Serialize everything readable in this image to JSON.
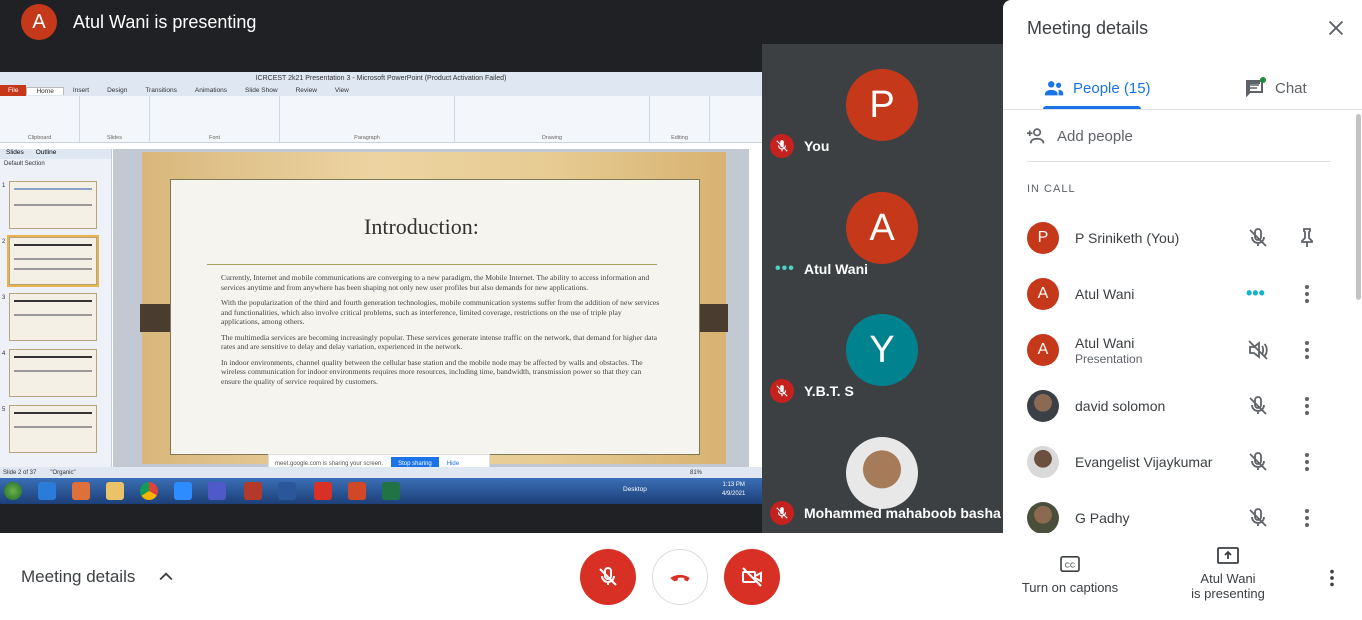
{
  "presenter": {
    "initial": "A",
    "title": "Atul Wani is presenting",
    "color": "#c5391a"
  },
  "shared_screen": {
    "window_title": "ICRCEST 2k21 Presentation 3 - Microsoft PowerPoint (Product Activation Failed)",
    "ribbon_tabs": [
      "File",
      "Home",
      "Insert",
      "Design",
      "Transitions",
      "Animations",
      "Slide Show",
      "Review",
      "View"
    ],
    "ribbon_groups": [
      "Clipboard",
      "Slides",
      "Font",
      "Paragraph",
      "Drawing",
      "Editing"
    ],
    "panel_tabs": [
      "Slides",
      "Outline"
    ],
    "section": "Default Section",
    "slide_title": "Introduction:",
    "bullets": [
      "Currently, Internet and mobile communications are converging to a new paradigm, the Mobile Internet. The ability to access information and services anytime and from anywhere has been shaping not only new user profiles but also demands for new applications.",
      "With the popularization of the third and fourth generation technologies, mobile communication systems suffer from the addition of new services and functionalities, which also involve critical problems, such as interference, limited coverage, restrictions on the use of triple play applications, among others.",
      "The multimedia services are becoming increasingly popular. These services generate intense traffic on the network, that demand for higher data rates and are sensitive to delay and delay variation, experienced in the network.",
      "In indoor environments, channel quality between the cellular base station and the mobile node may be affected by walls and obstacles. The wireless communication for indoor environments requires more resources, including time, bandwidth, transmission power so that they can ensure the quality of service required by customers."
    ],
    "status_slide": "Slide 2 of 37",
    "status_theme": "\"Organic\"",
    "zoom": "81%",
    "share_toast": "meet.google.com is sharing your screen.",
    "stop_label": "Stop sharing",
    "hide_label": "Hide",
    "clock_time": "1:13 PM",
    "clock_date": "4/9/2021",
    "desktop_label": "Desktop"
  },
  "tiles": [
    {
      "initial": "P",
      "name": "You",
      "color": "#c5391a",
      "muted": true
    },
    {
      "initial": "A",
      "name": "Atul Wani",
      "color": "#c5391a",
      "muted": false
    },
    {
      "initial": "Y",
      "name": "Y.B.T. S",
      "color": "#00838f",
      "muted": true
    },
    {
      "initial": "",
      "name": "Mohammed mahaboob basha",
      "color": "#ccc",
      "muted": true
    }
  ],
  "panel": {
    "title": "Meeting details",
    "people_tab": "People (15)",
    "chat_tab": "Chat",
    "add_people": "Add people",
    "in_call": "IN CALL",
    "participants": [
      {
        "initial": "P",
        "name": "P Sriniketh (You)",
        "sub": "",
        "color": "#c5391a"
      },
      {
        "initial": "A",
        "name": "Atul Wani",
        "sub": "",
        "color": "#c5391a"
      },
      {
        "initial": "A",
        "name": "Atul Wani",
        "sub": "Presentation",
        "color": "#c5391a"
      },
      {
        "initial": "",
        "name": "david solomon",
        "sub": "",
        "color": ""
      },
      {
        "initial": "",
        "name": "Evangelist Vijaykumar",
        "sub": "",
        "color": ""
      },
      {
        "initial": "",
        "name": "G Padhy",
        "sub": "",
        "color": ""
      }
    ]
  },
  "bottom": {
    "meeting_details": "Meeting details",
    "captions": "Turn on captions",
    "presenting_line1": "Atul Wani",
    "presenting_line2": "is presenting"
  },
  "colors": {
    "accent": "#1a73e8",
    "danger": "#d93025",
    "dark_bg": "#202124",
    "tile_bg": "#3c4043"
  }
}
